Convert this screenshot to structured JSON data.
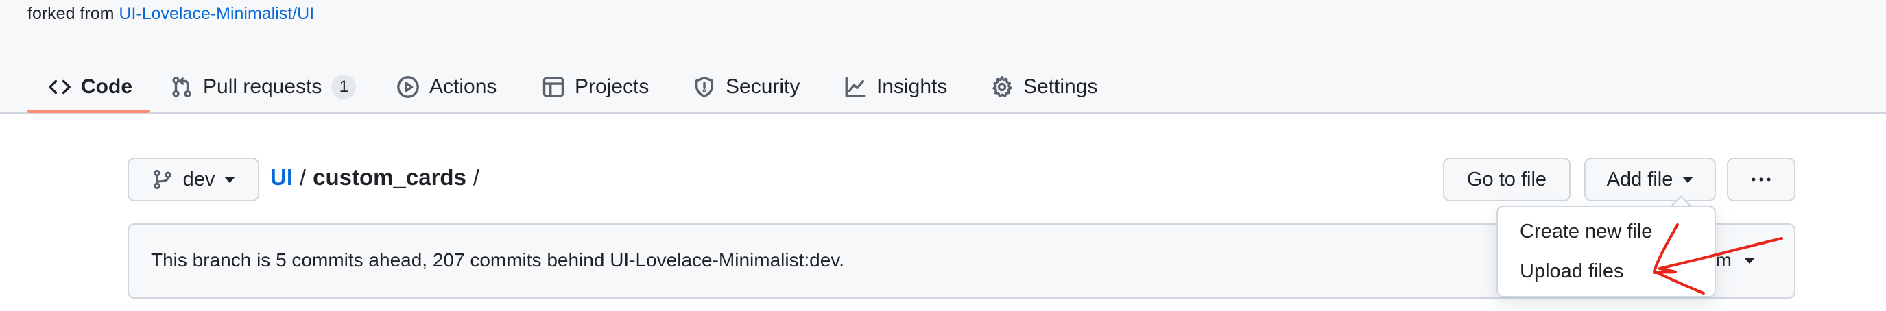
{
  "header": {
    "forked_prefix": "forked from",
    "forked_link": "UI-Lovelace-Minimalist/UI"
  },
  "tabs": [
    {
      "label": "Code",
      "icon": "code-icon",
      "selected": true
    },
    {
      "label": "Pull requests",
      "icon": "pull-request-icon",
      "count": "1"
    },
    {
      "label": "Actions",
      "icon": "play-icon"
    },
    {
      "label": "Projects",
      "icon": "table-icon"
    },
    {
      "label": "Security",
      "icon": "shield-icon"
    },
    {
      "label": "Insights",
      "icon": "graph-icon"
    },
    {
      "label": "Settings",
      "icon": "gear-icon"
    }
  ],
  "branch": {
    "label": "dev",
    "icon": "git-branch-icon"
  },
  "breadcrumb": {
    "repo": "UI",
    "sep1": "/",
    "dir": "custom_cards",
    "sep2": "/"
  },
  "toolbar": {
    "go_to_file": "Go to file",
    "add_file": "Add file",
    "more_icon": "kebab-horizontal-icon"
  },
  "flash": {
    "text": "This branch is 5 commits ahead, 207 commits behind UI-Lovelace-Minimalist:dev.",
    "right_partial": "am"
  },
  "add_file_menu": {
    "items": [
      "Create new file",
      "Upload files"
    ]
  },
  "annotation": {
    "color": "#e8261c",
    "shape": "hand-drawn-arrow"
  }
}
